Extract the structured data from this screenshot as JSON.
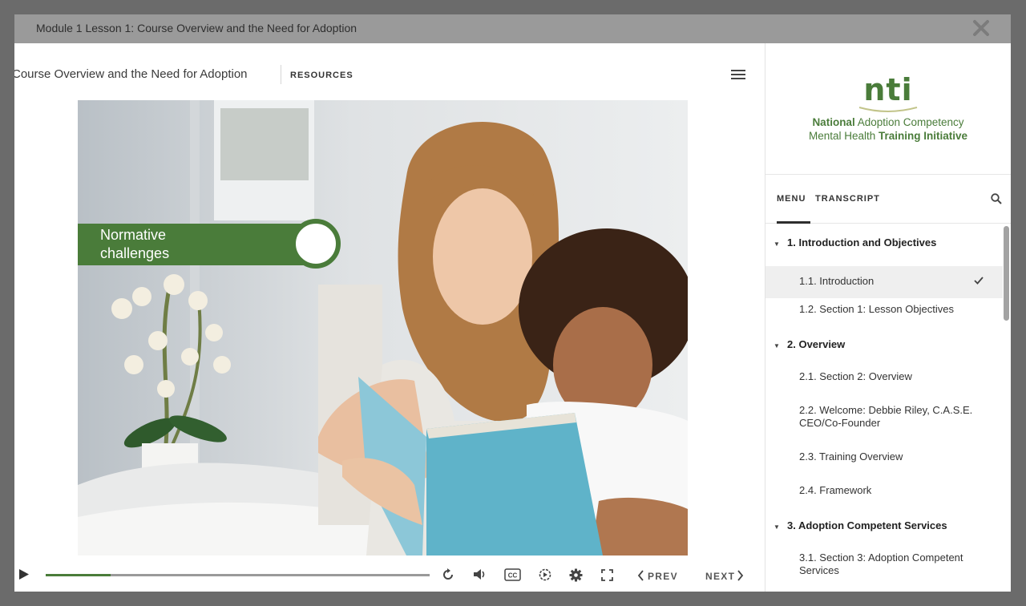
{
  "window": {
    "title": "Module 1 Lesson 1: Course Overview and the Need for Adoption"
  },
  "topbar": {
    "lesson_title": "Course Overview and the Need for Adoption",
    "resources_label": "RESOURCES"
  },
  "slide": {
    "banner_text": "Normative challenges"
  },
  "controls": {
    "progress": 0.17,
    "prev_label": "PREV",
    "next_label": "NEXT"
  },
  "logo": {
    "brand": "nti",
    "line1_bold": "National",
    "line1_rest": "Adoption Competency",
    "line2_rest": "Mental Health",
    "line2_bold": "Training Initiative"
  },
  "tabs": {
    "menu": "MENU",
    "transcript": "TRANSCRIPT"
  },
  "menu": [
    {
      "label": "1. Introduction and Objectives",
      "type": "section"
    },
    {
      "label": "1.1. Introduction",
      "type": "item",
      "active": true,
      "checked": true
    },
    {
      "label": "1.2. Section 1: Lesson Objectives",
      "type": "item"
    },
    {
      "label": "2. Overview",
      "type": "section"
    },
    {
      "label": "2.1. Section 2: Overview",
      "type": "item"
    },
    {
      "label": "2.2. Welcome: Debbie Riley, C.A.S.E. CEO/Co-Founder",
      "type": "item"
    },
    {
      "label": "2.3. Training Overview",
      "type": "item"
    },
    {
      "label": "2.4. Framework",
      "type": "item"
    },
    {
      "label": "3. Adoption Competent Services",
      "type": "section"
    },
    {
      "label": "3.1. Section 3: Adoption Competent Services",
      "type": "item"
    }
  ],
  "colors": {
    "accent": "#4a7c3a",
    "frame": "#6b6b6b",
    "titlebar": "#9a9a9a"
  }
}
